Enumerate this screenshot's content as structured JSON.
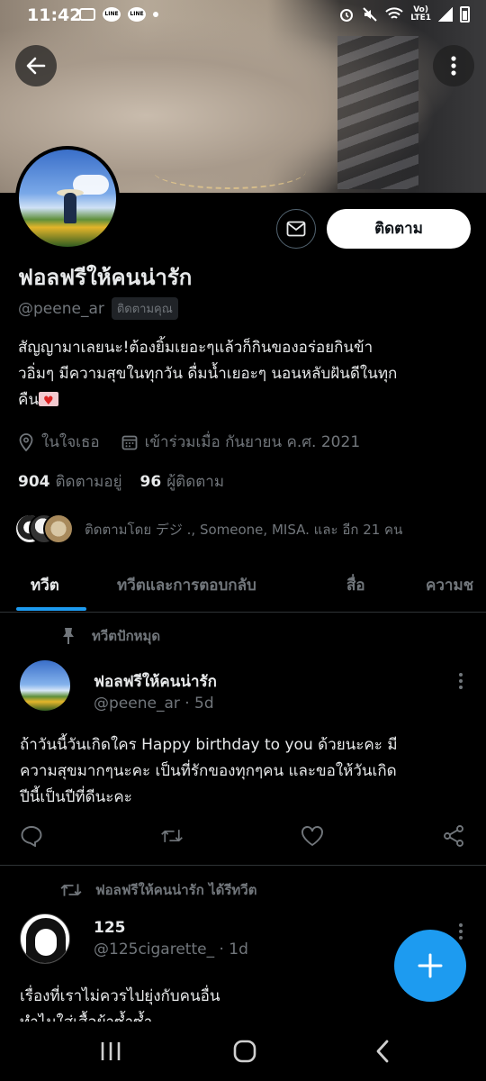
{
  "status_bar": {
    "time": "11:42",
    "network_label": "LTE1"
  },
  "profile": {
    "display_name": "ฟอลฟรีให้คนน่ารัก",
    "handle": "@peene_ar",
    "follows_you_badge": "ติดตามคุณ",
    "follow_button_label": "ติดตาม",
    "bio_line1": "สัญญามาเลยนะ!ต้องยิ้มเยอะๆแล้วก็กินของอร่อยกินข้า",
    "bio_line2": "วอิ่มๆ มีความสุขในทุกวัน ดื่มน้ำเยอะๆ นอนหลับฝันดีในทุก",
    "bio_line3": "คืน",
    "location": "ในใจเธอ",
    "joined": "เข้าร่วมเมื่อ กันยายน ค.ศ. 2021",
    "following_count": "904",
    "following_label": "ติดตามอยู่",
    "followers_count": "96",
    "followers_label": "ผู้ติดตาม",
    "followed_by_text": "ติดตามโดย デジ ., Someone, MISA. และ อีก 21 คน"
  },
  "tabs": [
    {
      "label": "ทวีต",
      "active": true
    },
    {
      "label": "ทวีตและการตอบกลับ",
      "active": false
    },
    {
      "label": "สื่อ",
      "active": false
    },
    {
      "label": "ความช",
      "active": false
    }
  ],
  "tweets": [
    {
      "context": "ทวีตปักหมุด",
      "name": "ฟอลฟรีให้คนน่ารัก",
      "handle_time": "@peene_ar · 5d",
      "line1": "ถ้าวันนี้วันเกิดใคร Happy birthday to you ด้วยนะคะ มี",
      "line2": "ความสุขมากๆนะคะ เป็นที่รักของทุกๆคน และขอให้วันเกิด",
      "line3": "ปีนี้เป็นปีที่ดีนะคะ"
    },
    {
      "context": "ฟอลฟรีให้คนน่ารัก ได้รีทวีต",
      "name": "125",
      "handle_time": "@125cigarette_ · 1d",
      "line1": "เรื่องที่เราไม่ควรไปยุ่งกับคนอื่น",
      "line2": "ทำไมใส่เสื้อผ้าซ้ำซ้ำ"
    }
  ],
  "colors": {
    "accent": "#1d9bf0",
    "background": "#000000",
    "secondary_text": "#71767b",
    "primary_text": "#e7e9ea"
  },
  "icons": [
    "back-arrow-icon",
    "more-vertical-icon",
    "mail-icon",
    "location-pin-icon",
    "calendar-icon",
    "pin-icon",
    "reply-icon",
    "retweet-icon",
    "like-icon",
    "share-icon",
    "compose-plus-icon",
    "recents-icon",
    "home-icon",
    "nav-back-icon"
  ]
}
